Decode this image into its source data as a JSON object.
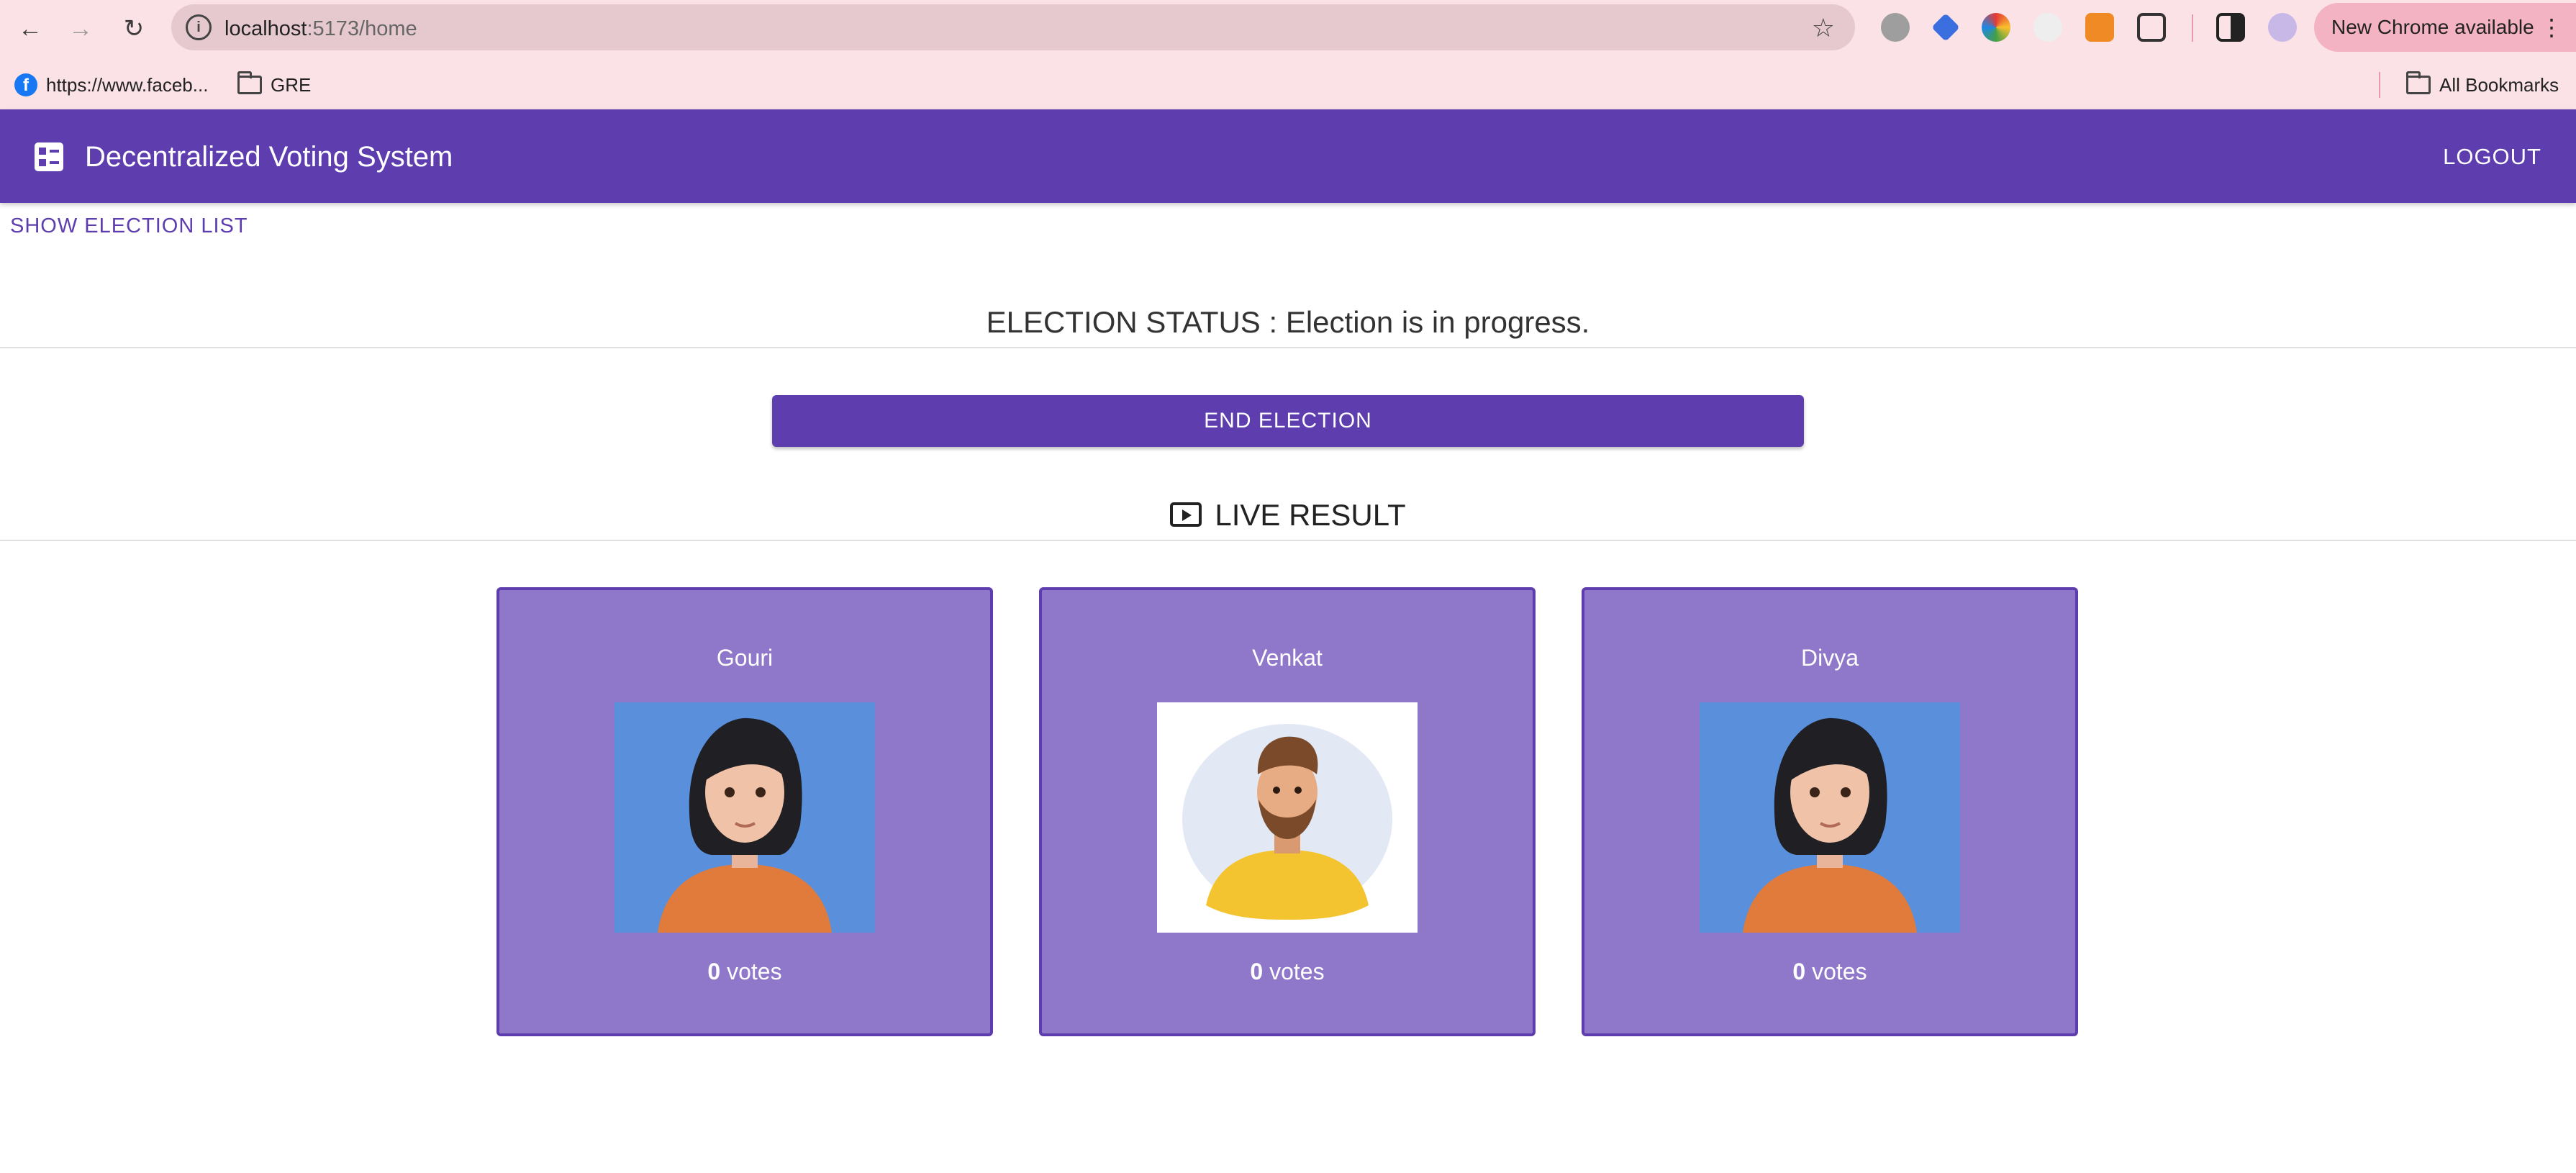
{
  "browser": {
    "url_host": "localhost",
    "url_path": ":5173/home",
    "new_chrome_label": "New Chrome available",
    "bookmarks": [
      {
        "label": "https://www.faceb..."
      },
      {
        "label": "GRE"
      }
    ],
    "all_bookmarks_label": "All Bookmarks"
  },
  "app": {
    "title": "Decentralized Voting System",
    "logout_label": "LOGOUT",
    "show_election_list_label": "SHOW ELECTION LIST",
    "status_text": "ELECTION STATUS : Election is in progress.",
    "end_election_label": "END ELECTION",
    "live_result_title": "LIVE RESULT",
    "accent_color": "#5e3eaf",
    "card_color": "#8f77c9"
  },
  "candidates": [
    {
      "name": "Gouri",
      "votes": "0",
      "votes_suffix": " votes",
      "avatar": "female-avatar"
    },
    {
      "name": "Venkat",
      "votes": "0",
      "votes_suffix": " votes",
      "avatar": "male-avatar"
    },
    {
      "name": "Divya",
      "votes": "0",
      "votes_suffix": " votes",
      "avatar": "female-avatar"
    }
  ]
}
